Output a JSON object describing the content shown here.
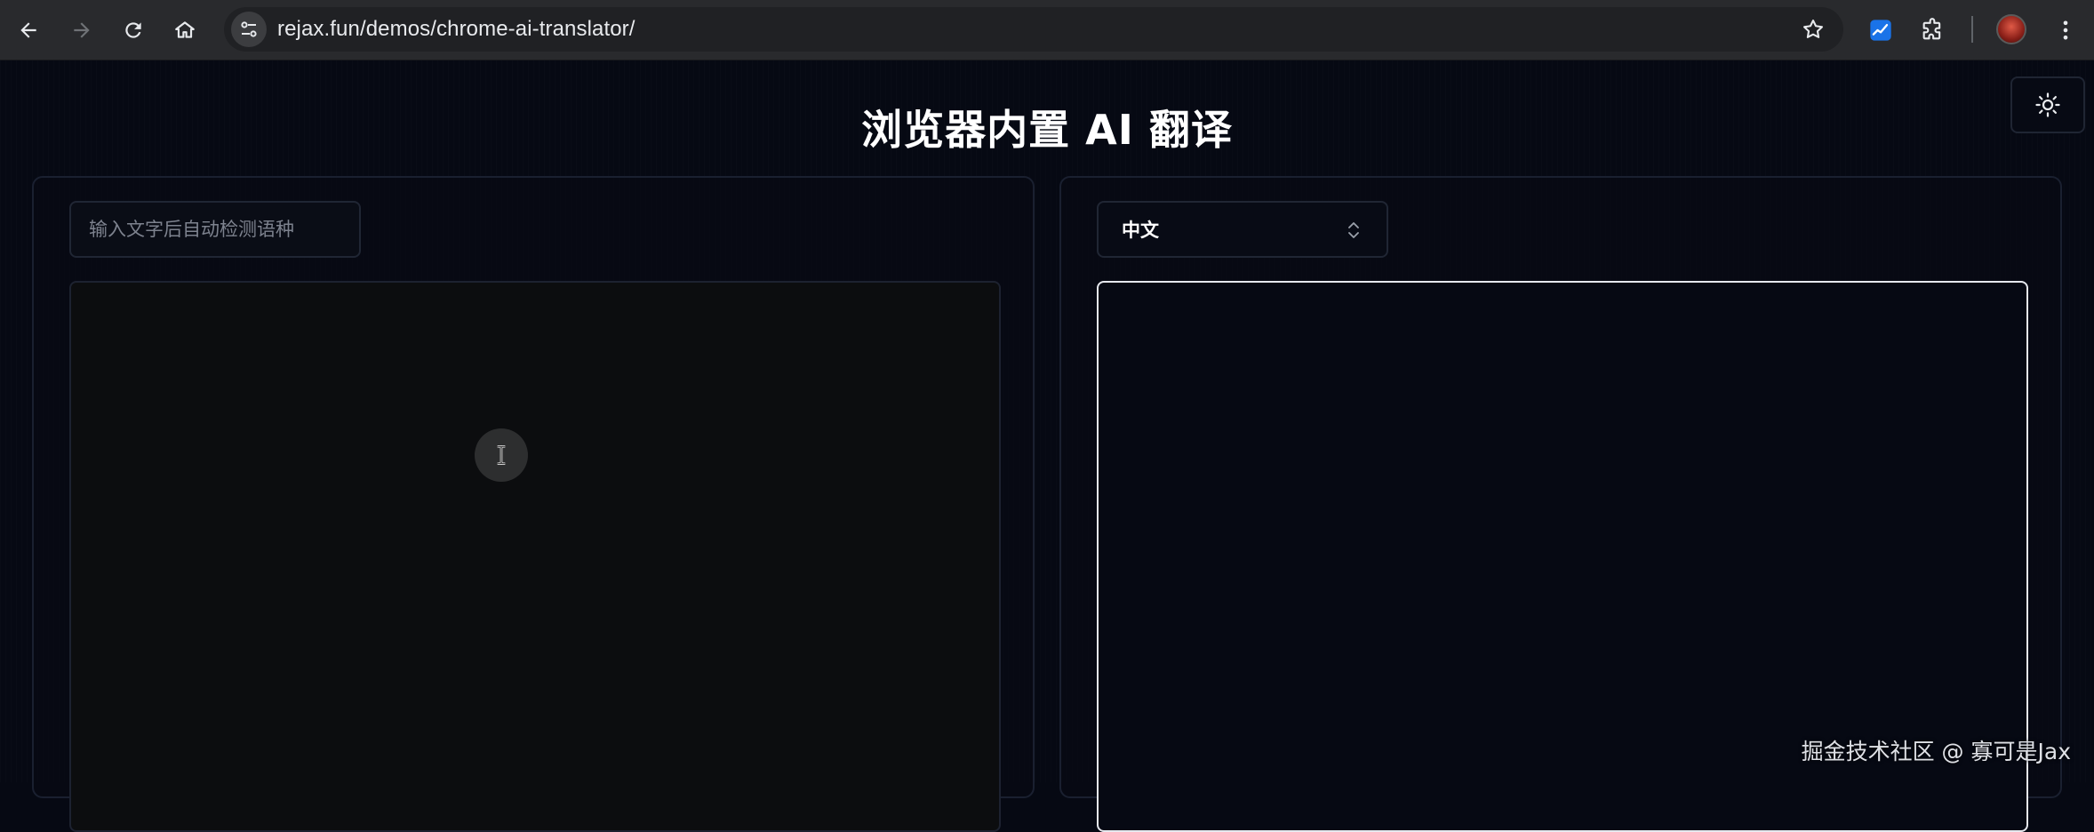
{
  "browser": {
    "url": "rejax.fun/demos/chrome-ai-translator/",
    "icons": {
      "back": "arrow-left-icon",
      "forward": "arrow-right-icon",
      "reload": "reload-icon",
      "home": "home-icon",
      "site_info": "tune-icon",
      "bookmark": "star-icon",
      "extension_1": "chart-icon",
      "extensions": "puzzle-icon",
      "menu": "kebab-menu-icon"
    },
    "colors": {
      "toolbar": "#292a2d",
      "omnibox": "#202124",
      "extension_accent": "#1a73e8"
    }
  },
  "page": {
    "title": "浏览器内置 AI 翻译",
    "theme_toggle_icon": "sun-icon",
    "source": {
      "language_placeholder": "输入文字后自动检测语种",
      "text_value": ""
    },
    "target": {
      "language_selected": "中文",
      "select_icon": "chevron-up-down-icon",
      "text_value": ""
    },
    "colors": {
      "background": "#060913",
      "title": "#ffffff",
      "focus_border": "#e6e8ee"
    }
  },
  "watermark": "掘金技术社区 @ 寡可是Jax"
}
